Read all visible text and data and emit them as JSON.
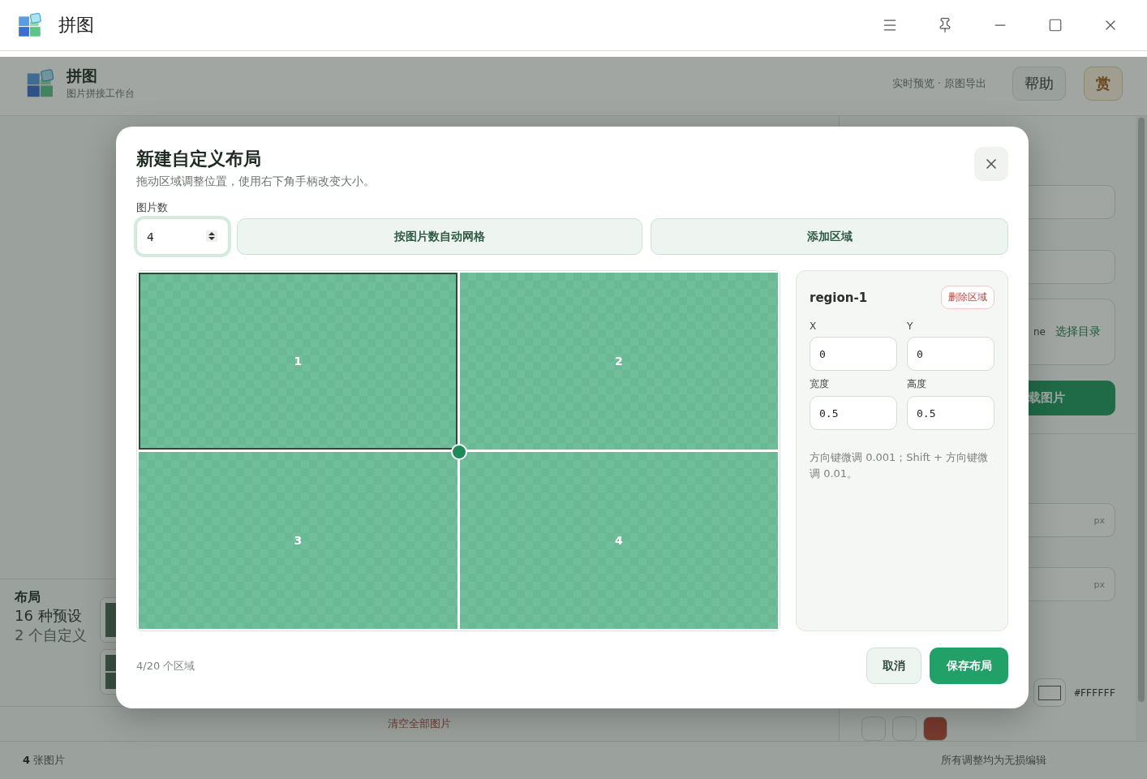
{
  "titlebar": {
    "title": "拼图"
  },
  "header": {
    "title": "拼图",
    "subtitle": "图片拼接工作台",
    "tagline": "实时预览 · 原图导出",
    "buttons": [
      {
        "label": "帮助",
        "kind": "plain"
      },
      {
        "label": "赏",
        "kind": "reward"
      }
    ]
  },
  "sidebar": {
    "section_title": "布局",
    "preset_count": "16 种预设",
    "custom_count": "2 个自定义"
  },
  "right_panel": {
    "folder_hint": "ne",
    "folder_button": "选择目录",
    "download_button": "载图片",
    "unit_fields": [
      "px",
      "px"
    ],
    "background_color": "#FFFFFF",
    "swatches": [
      {
        "kind": "blank"
      },
      {
        "kind": "blank"
      },
      {
        "kind": "filled"
      }
    ]
  },
  "clear_button": "清空全部图片",
  "status_bar": {
    "image_count": "**4** 张图片",
    "note": "所有调整均为无损编辑"
  },
  "dialog": {
    "title": "新建自定义布局",
    "subtitle": "拖动区域调整位置，使用右下角手柄改变大小。",
    "count_label": "图片数",
    "count_value": "4",
    "buttons": [
      "按图片数自动网格",
      "添加区域"
    ],
    "regions": [
      {
        "label": "1",
        "selected": true
      },
      {
        "label": "2",
        "selected": false
      },
      {
        "label": "3",
        "selected": false
      },
      {
        "label": "4",
        "selected": false
      }
    ],
    "inspector": {
      "name": "region-1",
      "delete_button": "删除区域",
      "fields": [
        {
          "label": "X",
          "value": "0"
        },
        {
          "label": "Y",
          "value": "0"
        },
        {
          "label": "宽度",
          "value": "0.5"
        },
        {
          "label": "高度",
          "value": "0.5"
        }
      ],
      "hint": "方向键微调 0.001；Shift + 方向键微调 0.01。"
    },
    "region_count": "4/20 个区域",
    "cancel": "取消",
    "save": "保存布局"
  }
}
